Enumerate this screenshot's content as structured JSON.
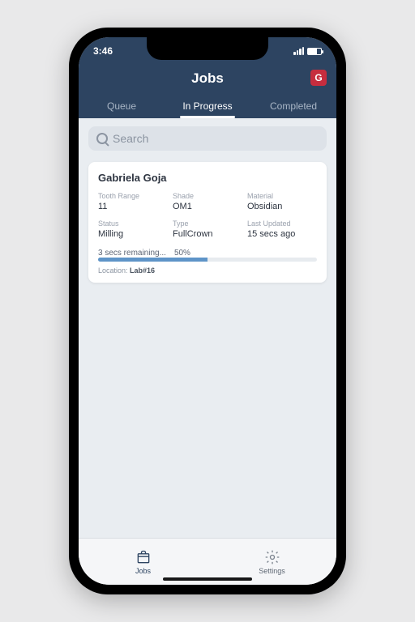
{
  "status_time": "3:46",
  "header": {
    "title": "Jobs",
    "badge": "G"
  },
  "tabs": [
    {
      "label": "Queue",
      "active": false
    },
    {
      "label": "In Progress",
      "active": true
    },
    {
      "label": "Completed",
      "active": false
    }
  ],
  "search": {
    "placeholder": "Search"
  },
  "card": {
    "patient": "Gabriela Goja",
    "fields": {
      "tooth_range_label": "Tooth Range",
      "tooth_range": "11",
      "shade_label": "Shade",
      "shade": "OM1",
      "material_label": "Material",
      "material": "Obsidian",
      "status_label": "Status",
      "status": "Milling",
      "type_label": "Type",
      "type": "FullCrown",
      "last_updated_label": "Last Updated",
      "last_updated": "15 secs ago"
    },
    "progress": {
      "remaining": "3 secs remaining...",
      "percent": "50%",
      "value": 50
    },
    "location_label": "Location: ",
    "location_value": "Lab#16"
  },
  "tabbar": {
    "jobs": "Jobs",
    "settings": "Settings"
  }
}
